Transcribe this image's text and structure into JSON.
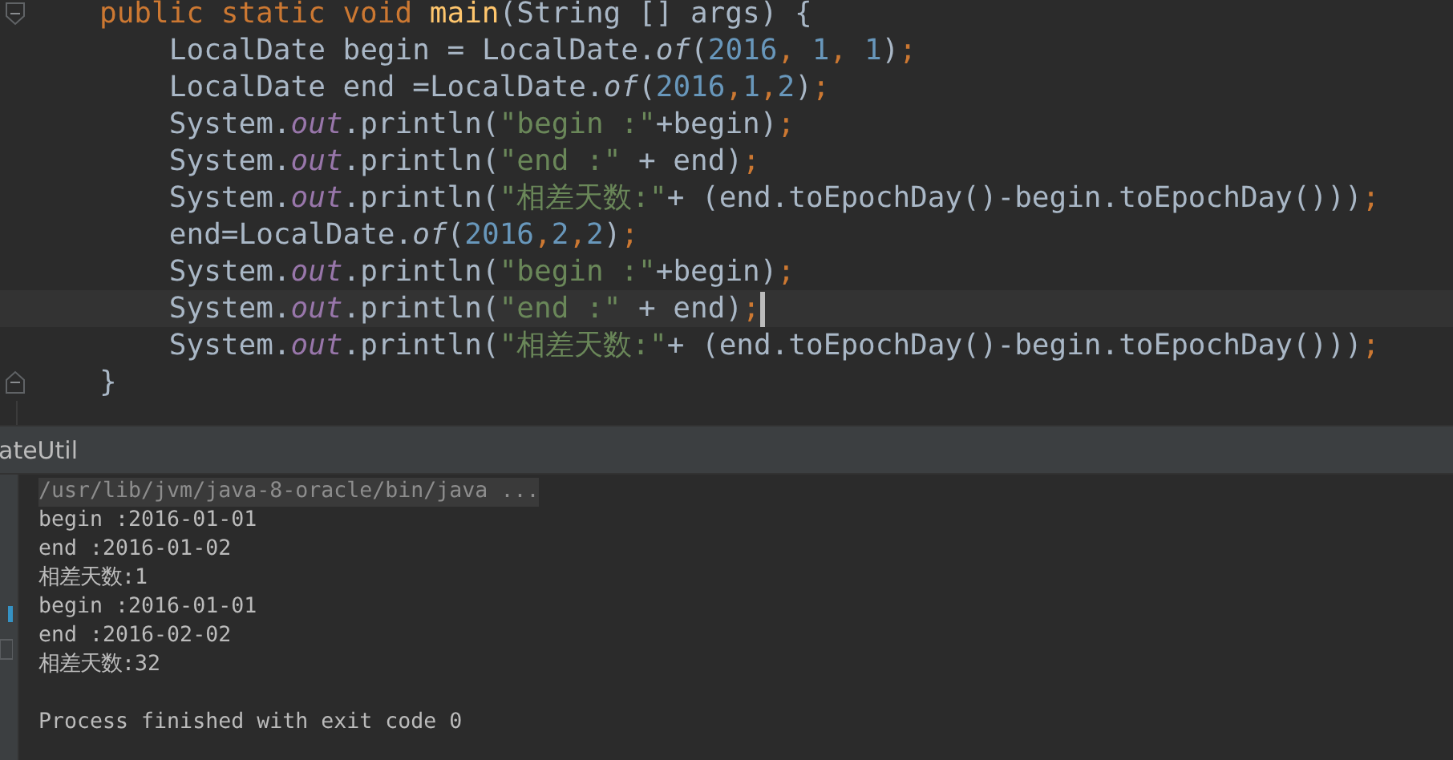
{
  "editor": {
    "lines": [
      {
        "current": false,
        "fold_marker": true,
        "tokens": [
          {
            "kind": "keyword",
            "text": "public static void "
          },
          {
            "kind": "method",
            "text": "main"
          },
          {
            "kind": "plain",
            "text": "(String [] args) {"
          }
        ],
        "children": [
          {
            "current": false,
            "tokens": [
              {
                "kind": "plain",
                "text": "LocalDate begin = LocalDate."
              },
              {
                "kind": "static",
                "text": "of"
              },
              {
                "kind": "plain",
                "text": "("
              },
              {
                "kind": "number",
                "text": "2016"
              },
              {
                "kind": "punct",
                "text": ", "
              },
              {
                "kind": "number",
                "text": "1"
              },
              {
                "kind": "punct",
                "text": ", "
              },
              {
                "kind": "number",
                "text": "1"
              },
              {
                "kind": "plain",
                "text": ")"
              },
              {
                "kind": "punct",
                "text": ";"
              }
            ]
          },
          {
            "current": false,
            "tokens": [
              {
                "kind": "plain",
                "text": "LocalDate end =LocalDate."
              },
              {
                "kind": "static",
                "text": "of"
              },
              {
                "kind": "plain",
                "text": "("
              },
              {
                "kind": "number",
                "text": "2016"
              },
              {
                "kind": "punct",
                "text": ","
              },
              {
                "kind": "number",
                "text": "1"
              },
              {
                "kind": "punct",
                "text": ","
              },
              {
                "kind": "number",
                "text": "2"
              },
              {
                "kind": "plain",
                "text": ")"
              },
              {
                "kind": "punct",
                "text": ";"
              }
            ]
          },
          {
            "current": false,
            "tokens": [
              {
                "kind": "plain",
                "text": "System."
              },
              {
                "kind": "field",
                "text": "out"
              },
              {
                "kind": "plain",
                "text": ".println("
              },
              {
                "kind": "string",
                "text": "\"begin :\""
              },
              {
                "kind": "plain",
                "text": "+begin)"
              },
              {
                "kind": "punct",
                "text": ";"
              }
            ]
          },
          {
            "current": false,
            "tokens": [
              {
                "kind": "plain",
                "text": "System."
              },
              {
                "kind": "field",
                "text": "out"
              },
              {
                "kind": "plain",
                "text": ".println("
              },
              {
                "kind": "string",
                "text": "\"end :\""
              },
              {
                "kind": "plain",
                "text": " + end)"
              },
              {
                "kind": "punct",
                "text": ";"
              }
            ]
          },
          {
            "current": false,
            "tokens": [
              {
                "kind": "plain",
                "text": "System."
              },
              {
                "kind": "field",
                "text": "out"
              },
              {
                "kind": "plain",
                "text": ".println("
              },
              {
                "kind": "string",
                "text": "\"相差天数:\""
              },
              {
                "kind": "plain",
                "text": "+ (end.toEpochDay()-begin.toEpochDay()))"
              },
              {
                "kind": "punct",
                "text": ";"
              }
            ]
          },
          {
            "current": false,
            "tokens": [
              {
                "kind": "plain",
                "text": "end=LocalDate."
              },
              {
                "kind": "static",
                "text": "of"
              },
              {
                "kind": "plain",
                "text": "("
              },
              {
                "kind": "number",
                "text": "2016"
              },
              {
                "kind": "punct",
                "text": ","
              },
              {
                "kind": "number",
                "text": "2"
              },
              {
                "kind": "punct",
                "text": ","
              },
              {
                "kind": "number",
                "text": "2"
              },
              {
                "kind": "plain",
                "text": ")"
              },
              {
                "kind": "punct",
                "text": ";"
              }
            ]
          },
          {
            "current": false,
            "tokens": [
              {
                "kind": "plain",
                "text": "System."
              },
              {
                "kind": "field",
                "text": "out"
              },
              {
                "kind": "plain",
                "text": ".println("
              },
              {
                "kind": "string",
                "text": "\"begin :\""
              },
              {
                "kind": "plain",
                "text": "+begin)"
              },
              {
                "kind": "punct",
                "text": ";"
              }
            ]
          },
          {
            "current": true,
            "tokens": [
              {
                "kind": "plain",
                "text": "System."
              },
              {
                "kind": "field",
                "text": "out"
              },
              {
                "kind": "plain",
                "text": ".println("
              },
              {
                "kind": "string",
                "text": "\"end :\""
              },
              {
                "kind": "plain",
                "text": " + end)"
              },
              {
                "kind": "punct",
                "text": ";"
              }
            ]
          },
          {
            "current": false,
            "tokens": [
              {
                "kind": "plain",
                "text": "System."
              },
              {
                "kind": "field",
                "text": "out"
              },
              {
                "kind": "plain",
                "text": ".println("
              },
              {
                "kind": "string",
                "text": "\"相差天数:\""
              },
              {
                "kind": "plain",
                "text": "+ (end.toEpochDay()-begin.toEpochDay()))"
              },
              {
                "kind": "punct",
                "text": ";"
              }
            ]
          }
        ]
      },
      {
        "current": false,
        "fold_marker": true,
        "tokens": [
          {
            "kind": "plain",
            "text": "}"
          }
        ]
      }
    ]
  },
  "run_panel": {
    "title": "ateUtil",
    "lines": [
      {
        "kind": "command",
        "text": "/usr/lib/jvm/java-8-oracle/bin/java ..."
      },
      {
        "kind": "output",
        "text": "begin :2016-01-01"
      },
      {
        "kind": "output",
        "text": "end :2016-01-02"
      },
      {
        "kind": "output",
        "text": "相差天数:1"
      },
      {
        "kind": "output",
        "text": "begin :2016-01-01"
      },
      {
        "kind": "output",
        "text": "end :2016-02-02"
      },
      {
        "kind": "output",
        "text": "相差天数:32"
      },
      {
        "kind": "exit",
        "text": "Process finished with exit code 0"
      }
    ]
  }
}
